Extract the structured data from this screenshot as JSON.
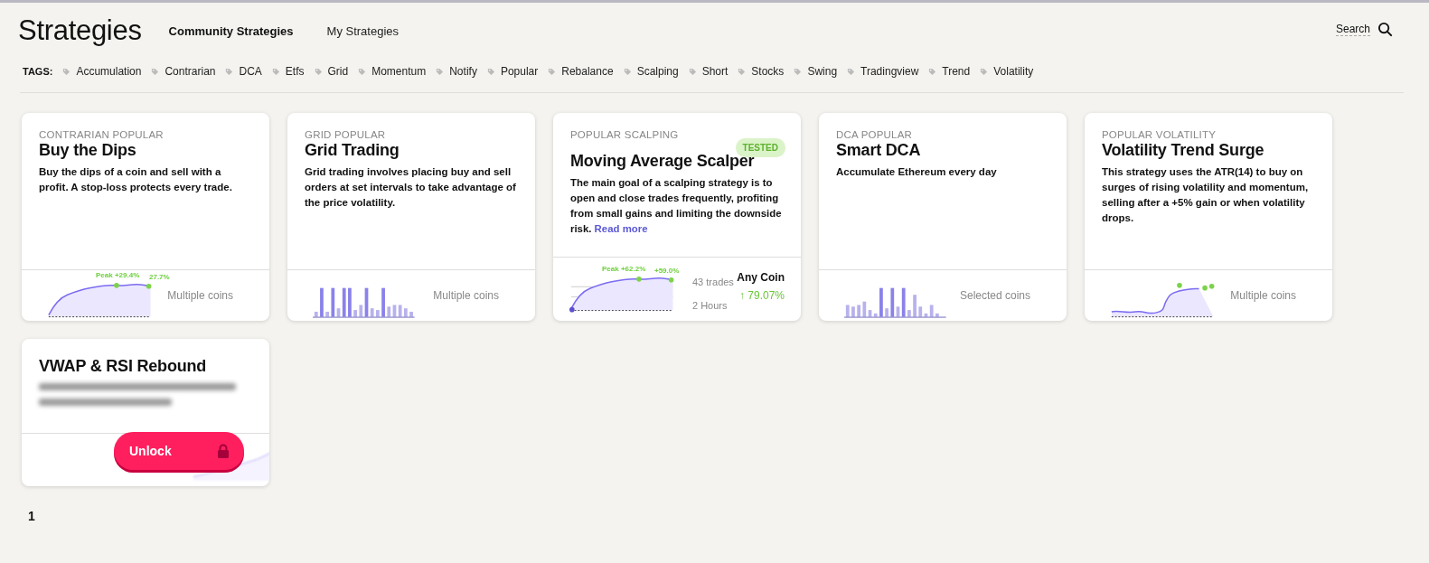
{
  "header": {
    "title": "Strategies",
    "tabs": [
      {
        "label": "Community Strategies",
        "selected": true
      },
      {
        "label": "My Strategies",
        "selected": false
      }
    ],
    "search_label": "Search"
  },
  "tags": {
    "label": "TAGS:",
    "items": [
      "Accumulation",
      "Contrarian",
      "DCA",
      "Etfs",
      "Grid",
      "Momentum",
      "Notify",
      "Popular",
      "Rebalance",
      "Scalping",
      "Short",
      "Stocks",
      "Swing",
      "Tradingview",
      "Trend",
      "Volatility"
    ]
  },
  "cards": [
    {
      "kind": "standard",
      "tags": "CONTRARIAN POPULAR",
      "title": "Buy the Dips",
      "description": "Buy the dips of a coin and sell with a profit. A stop-loss protects every trade.",
      "chart": {
        "kind": "line"
      },
      "peak_label": "Peak +29.4%",
      "end_label": "27.7%",
      "coins": "Multiple coins"
    },
    {
      "kind": "standard",
      "tags": "GRID POPULAR",
      "title": "Grid Trading",
      "description": "Grid trading involves placing buy and sell orders at set intervals to take advantage of the price volatility.",
      "chart": {
        "kind": "bar"
      },
      "coins": "Multiple coins"
    },
    {
      "kind": "tested",
      "tags": "POPULAR SCALPING",
      "badge": "TESTED",
      "title": "Moving Average Scalper",
      "description": "The main goal of a scalping strategy is to open and close trades frequently, profiting from small gains and limiting the downside risk.",
      "read_more": "Read more",
      "chart": {
        "kind": "line"
      },
      "peak_label": "Peak +62.2%",
      "end_label": "+59.0%",
      "trades": "43 trades",
      "duration": "2 Hours",
      "coin": "Any Coin",
      "gain": "↑ 79.07%"
    },
    {
      "kind": "standard",
      "tags": "DCA POPULAR",
      "title": "Smart DCA",
      "description": "Accumulate Ethereum every day",
      "chart": {
        "kind": "bar"
      },
      "coins": "Selected coins"
    },
    {
      "kind": "standard",
      "tags": "POPULAR VOLATILITY",
      "title": "Volatility Trend Surge",
      "description": "This strategy uses the ATR(14) to buy on surges of rising volatility and momentum, selling after a +5% gain or when volatility drops.",
      "chart": {
        "kind": "surge"
      },
      "coins": "Multiple coins"
    },
    {
      "kind": "locked",
      "title": "VWAP & RSI Rebound",
      "unlock_label": "Unlock"
    }
  ],
  "pagination": [
    "1"
  ]
}
